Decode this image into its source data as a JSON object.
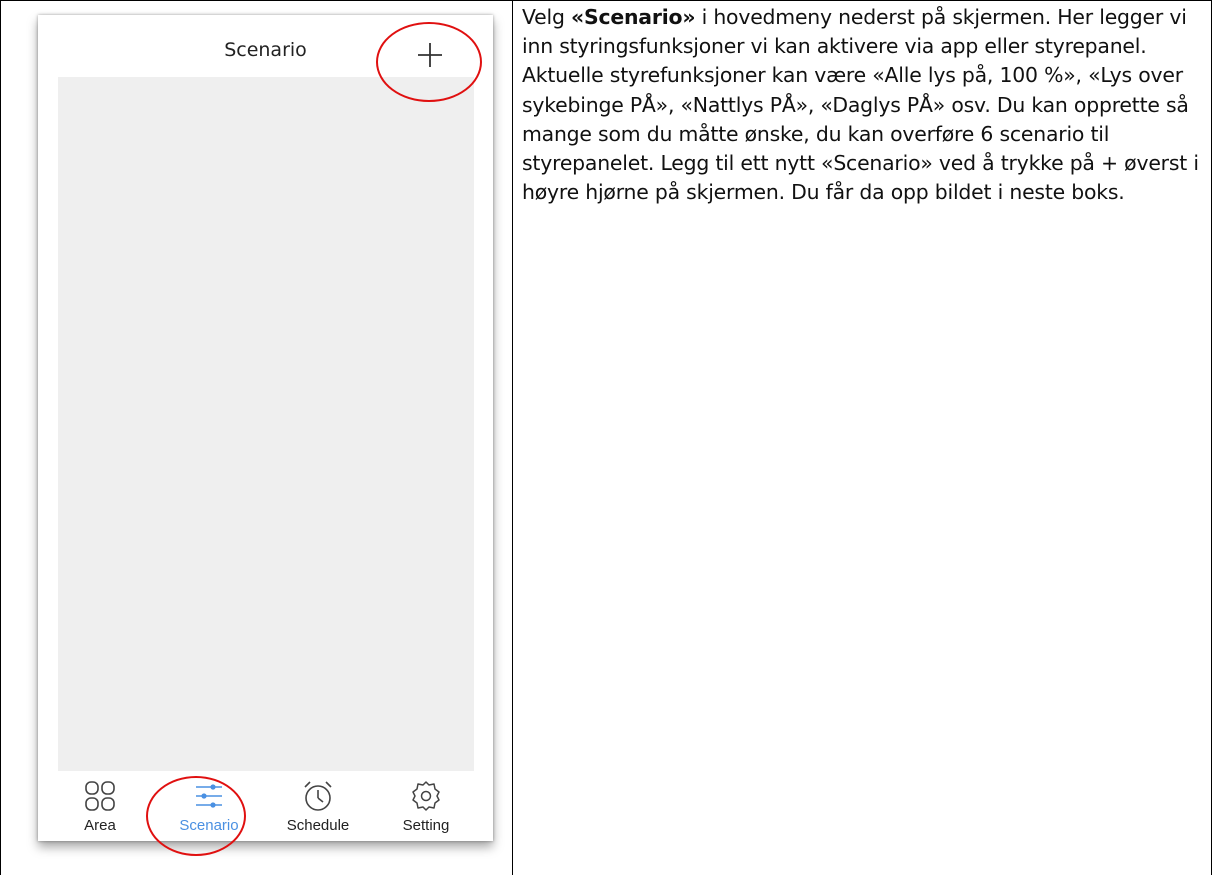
{
  "app": {
    "title": "Scenario",
    "add_label": "+"
  },
  "tabs": [
    {
      "label": "Area",
      "icon": "grid-icon",
      "active": false
    },
    {
      "label": "Scenario",
      "icon": "sliders-icon",
      "active": true
    },
    {
      "label": "Schedule",
      "icon": "alarm-clock-icon",
      "active": false
    },
    {
      "label": "Setting",
      "icon": "gear-icon",
      "active": false
    }
  ],
  "colors": {
    "accent": "#4a90e2",
    "highlight": "#e01010",
    "content_bg": "#efefef"
  },
  "instructions": {
    "prefix": "Velg ",
    "bold": "«Scenario»",
    "body": " i hovedmeny nederst på skjermen. Her legger vi inn styringsfunksjoner vi kan aktivere via app eller styrepanel. Aktuelle styrefunksjoner kan være «Alle lys på, 100 %», «Lys over sykebinge PÅ», «Nattlys PÅ», «Daglys PÅ» osv. Du kan opprette så mange som du måtte ønske, du kan overføre 6 scenario til styrepanelet. Legg til ett nytt «Scenario» ved å trykke på + øverst i høyre hjørne på skjermen. Du får da opp bildet i neste boks."
  }
}
